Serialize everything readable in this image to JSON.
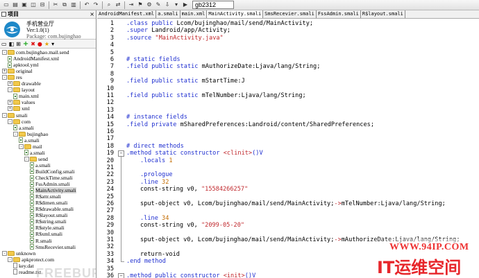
{
  "toolbar": {
    "encoding_value": "gb2312"
  },
  "project_panel": {
    "title": "项目",
    "pin_glyph": "×",
    "app_name": "手机营业厅",
    "app_version": "Ver:1.0(1)",
    "app_package": "Package: com.bujinghao",
    "tree": [
      {
        "label": "com.bujinghao.mail.send",
        "indent": 0,
        "kind": "root",
        "exp": "-"
      },
      {
        "label": "AndroidManifest.xml",
        "indent": 1,
        "kind": "file"
      },
      {
        "label": "apktool.yml",
        "indent": 1,
        "kind": "file"
      },
      {
        "label": "original",
        "indent": 0,
        "kind": "folder",
        "exp": "+"
      },
      {
        "label": "res",
        "indent": 0,
        "kind": "folder",
        "exp": "-"
      },
      {
        "label": "drawable",
        "indent": 1,
        "kind": "folder",
        "exp": "+"
      },
      {
        "label": "layout",
        "indent": 1,
        "kind": "folder",
        "exp": "-"
      },
      {
        "label": "main.xml",
        "indent": 2,
        "kind": "file"
      },
      {
        "label": "values",
        "indent": 1,
        "kind": "folder",
        "exp": "+"
      },
      {
        "label": "xml",
        "indent": 1,
        "kind": "folder",
        "exp": "+"
      },
      {
        "label": "smali",
        "indent": 0,
        "kind": "folder",
        "exp": "-"
      },
      {
        "label": "com",
        "indent": 1,
        "kind": "folder",
        "exp": "-"
      },
      {
        "label": "a.smali",
        "indent": 2,
        "kind": "file"
      },
      {
        "label": "bujinghao",
        "indent": 2,
        "kind": "folder",
        "exp": "-"
      },
      {
        "label": "a.smali",
        "indent": 3,
        "kind": "file"
      },
      {
        "label": "mail",
        "indent": 3,
        "kind": "folder",
        "exp": "-"
      },
      {
        "label": "a.smali",
        "indent": 4,
        "kind": "file"
      },
      {
        "label": "send",
        "indent": 4,
        "kind": "folder",
        "exp": "-"
      },
      {
        "label": "a.smali",
        "indent": 5,
        "kind": "file"
      },
      {
        "label": "BuildConfig.smali",
        "indent": 5,
        "kind": "file"
      },
      {
        "label": "CheckTime.smali",
        "indent": 5,
        "kind": "file"
      },
      {
        "label": "FssAdmin.smali",
        "indent": 5,
        "kind": "file"
      },
      {
        "label": "MainActivity.smali",
        "indent": 5,
        "kind": "file",
        "selected": true
      },
      {
        "label": "R$attr.smali",
        "indent": 5,
        "kind": "file"
      },
      {
        "label": "R$dimen.smali",
        "indent": 5,
        "kind": "file"
      },
      {
        "label": "R$drawable.smali",
        "indent": 5,
        "kind": "file"
      },
      {
        "label": "R$layout.smali",
        "indent": 5,
        "kind": "file"
      },
      {
        "label": "R$string.smali",
        "indent": 5,
        "kind": "file"
      },
      {
        "label": "R$style.smali",
        "indent": 5,
        "kind": "file"
      },
      {
        "label": "R$xml.smali",
        "indent": 5,
        "kind": "file"
      },
      {
        "label": "R.smali",
        "indent": 5,
        "kind": "file"
      },
      {
        "label": "SmsRecevier.smali",
        "indent": 5,
        "kind": "file"
      },
      {
        "label": "unknown",
        "indent": 0,
        "kind": "folder",
        "exp": "-"
      },
      {
        "label": "apkprotect.com",
        "indent": 1,
        "kind": "folder",
        "exp": "-"
      },
      {
        "label": "key.dat",
        "indent": 2,
        "kind": "doc"
      },
      {
        "label": "readme.txt",
        "indent": 2,
        "kind": "doc"
      }
    ]
  },
  "tabs": [
    {
      "label": "AndroidManifest.xml"
    },
    {
      "label": "a.smali"
    },
    {
      "label": "main.xml"
    },
    {
      "label": "MainActivity.smali",
      "active": true
    },
    {
      "label": "SmsRecevier.smali"
    },
    {
      "label": "FssAdmin.smali"
    },
    {
      "label": "R$layout.smali"
    }
  ],
  "editor": {
    "lines": [
      {
        "n": "1",
        "parts": [
          [
            "k",
            ".class public "
          ],
          [
            "t",
            "Lcom/bujinghao/mail/send/MainActivity;"
          ]
        ]
      },
      {
        "n": "2",
        "parts": [
          [
            "k",
            ".super "
          ],
          [
            "t",
            "Landroid/app/Activity;"
          ]
        ]
      },
      {
        "n": "3",
        "parts": [
          [
            "k",
            ".source "
          ],
          [
            "s",
            "\"MainActivity.java\""
          ]
        ]
      },
      {
        "n": "4",
        "parts": []
      },
      {
        "n": "5",
        "parts": []
      },
      {
        "n": "6",
        "parts": [
          [
            "c",
            "# static fields"
          ]
        ]
      },
      {
        "n": "7",
        "parts": [
          [
            "k",
            ".field public static "
          ],
          [
            "t",
            "mAuthorizeDate:Ljava/lang/String;"
          ]
        ]
      },
      {
        "n": "8",
        "parts": []
      },
      {
        "n": "9",
        "parts": [
          [
            "k",
            ".field public static "
          ],
          [
            "t",
            "mStartTime:J"
          ]
        ]
      },
      {
        "n": "10",
        "parts": []
      },
      {
        "n": "11",
        "parts": [
          [
            "k",
            ".field public static "
          ],
          [
            "t",
            "mTelNumber:Ljava/lang/String;"
          ]
        ]
      },
      {
        "n": "12",
        "parts": []
      },
      {
        "n": "13",
        "parts": []
      },
      {
        "n": "14",
        "parts": [
          [
            "c",
            "# instance fields"
          ]
        ]
      },
      {
        "n": "15",
        "parts": [
          [
            "k",
            ".field private "
          ],
          [
            "t",
            "mSharedPreferences:Landroid/content/SharedPreferences;"
          ]
        ]
      },
      {
        "n": "16",
        "parts": []
      },
      {
        "n": "17",
        "parts": []
      },
      {
        "n": "18",
        "parts": [
          [
            "c",
            "# direct methods"
          ]
        ]
      },
      {
        "n": "19",
        "parts": [
          [
            "k",
            ".method static constructor "
          ],
          [
            "s",
            "<clinit>"
          ],
          [
            "k",
            "()V"
          ]
        ]
      },
      {
        "n": "20",
        "indent": true,
        "parts": [
          [
            "k",
            ".locals "
          ],
          [
            "n",
            "1"
          ]
        ]
      },
      {
        "n": "21",
        "parts": []
      },
      {
        "n": "22",
        "indent": true,
        "parts": [
          [
            "k",
            ".prologue"
          ]
        ]
      },
      {
        "n": "23",
        "indent": true,
        "parts": [
          [
            "k",
            ".line "
          ],
          [
            "n",
            "32"
          ]
        ]
      },
      {
        "n": "24",
        "indent": true,
        "parts": [
          [
            "t",
            "const-string v0, "
          ],
          [
            "s",
            "\"15584266257\""
          ]
        ]
      },
      {
        "n": "25",
        "parts": []
      },
      {
        "n": "26",
        "indent": true,
        "parts": [
          [
            "t",
            "sput-object v0, Lcom/bujinghao/mail/send/MainActivity;"
          ],
          [
            "s",
            "->"
          ],
          [
            "t",
            "mTelNumber:Ljava/lang/String;"
          ]
        ]
      },
      {
        "n": "27",
        "parts": []
      },
      {
        "n": "28",
        "indent": true,
        "parts": [
          [
            "k",
            ".line "
          ],
          [
            "n",
            "34"
          ]
        ]
      },
      {
        "n": "29",
        "indent": true,
        "parts": [
          [
            "t",
            "const-string v0, "
          ],
          [
            "s",
            "\"2099-05-20\""
          ]
        ]
      },
      {
        "n": "30",
        "parts": []
      },
      {
        "n": "31",
        "indent": true,
        "parts": [
          [
            "t",
            "sput-object v0, Lcom/bujinghao/mail/send/MainActivity;"
          ],
          [
            "s",
            "->"
          ],
          [
            "t",
            "mAuthorizeDate:Ljava/lang/String;"
          ]
        ]
      },
      {
        "n": "32",
        "parts": []
      },
      {
        "n": "33",
        "indent": true,
        "parts": [
          [
            "t",
            "return-void"
          ]
        ]
      },
      {
        "n": "34",
        "parts": [
          [
            "k",
            ".end method"
          ]
        ]
      },
      {
        "n": "35",
        "parts": []
      },
      {
        "n": "36",
        "parts": [
          [
            "k",
            ".method public constructor "
          ],
          [
            "s",
            "<init>"
          ],
          [
            "k",
            "()V"
          ]
        ]
      }
    ]
  },
  "watermark": {
    "url": "WWW.94IP.COM",
    "brand": "IT运维空间",
    "free_mark": "FREEBUF"
  },
  "colors": {
    "keyword": "#1f2fd0",
    "string": "#c0282d",
    "number": "#c26b00",
    "watermark_red": "#e7262b"
  }
}
